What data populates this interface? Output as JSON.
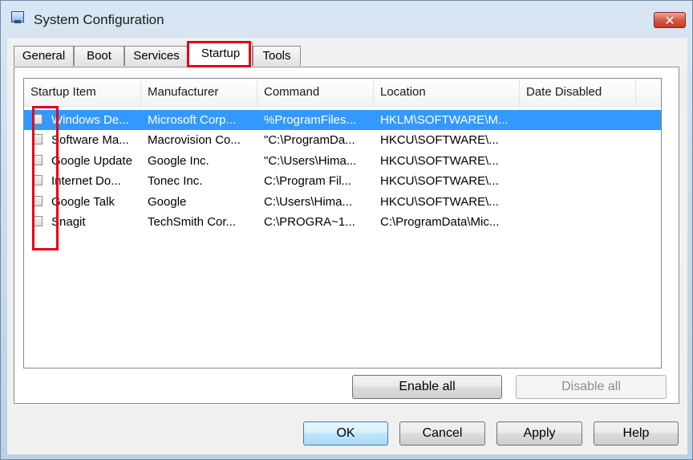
{
  "window": {
    "title": "System Configuration",
    "close_label": "✕"
  },
  "tabs": [
    {
      "label": "General",
      "active": false
    },
    {
      "label": "Boot",
      "active": false
    },
    {
      "label": "Services",
      "active": false
    },
    {
      "label": "Startup",
      "active": true
    },
    {
      "label": "Tools",
      "active": false
    }
  ],
  "list": {
    "columns": [
      "Startup Item",
      "Manufacturer",
      "Command",
      "Location",
      "Date Disabled"
    ],
    "rows": [
      {
        "checked": false,
        "selected": true,
        "item": "Windows De...",
        "manufacturer": "Microsoft Corp...",
        "command": "%ProgramFiles...",
        "location": "HKLM\\SOFTWARE\\M...",
        "date_disabled": ""
      },
      {
        "checked": false,
        "selected": false,
        "item": "Software Ma...",
        "manufacturer": "Macrovision Co...",
        "command": "\"C:\\ProgramDa...",
        "location": "HKCU\\SOFTWARE\\...",
        "date_disabled": ""
      },
      {
        "checked": false,
        "selected": false,
        "item": "Google Update",
        "manufacturer": "Google Inc.",
        "command": "\"C:\\Users\\Hima...",
        "location": "HKCU\\SOFTWARE\\...",
        "date_disabled": ""
      },
      {
        "checked": false,
        "selected": false,
        "item": "Internet Do...",
        "manufacturer": "Tonec Inc.",
        "command": "C:\\Program Fil...",
        "location": "HKCU\\SOFTWARE\\...",
        "date_disabled": ""
      },
      {
        "checked": false,
        "selected": false,
        "item": "Google Talk",
        "manufacturer": "Google",
        "command": "C:\\Users\\Hima...",
        "location": "HKCU\\SOFTWARE\\...",
        "date_disabled": ""
      },
      {
        "checked": false,
        "selected": false,
        "item": "Snagit",
        "manufacturer": "TechSmith Cor...",
        "command": "C:\\PROGRA~1...",
        "location": "C:\\ProgramData\\Mic...",
        "date_disabled": ""
      }
    ]
  },
  "panel_buttons": {
    "enable_all": "Enable all",
    "disable_all": "Disable all"
  },
  "dialog_buttons": {
    "ok": "OK",
    "cancel": "Cancel",
    "apply": "Apply",
    "help": "Help"
  },
  "colors": {
    "selection": "#3399ff",
    "highlight_annotation": "#e3001b",
    "close_button": "#c13d27"
  }
}
